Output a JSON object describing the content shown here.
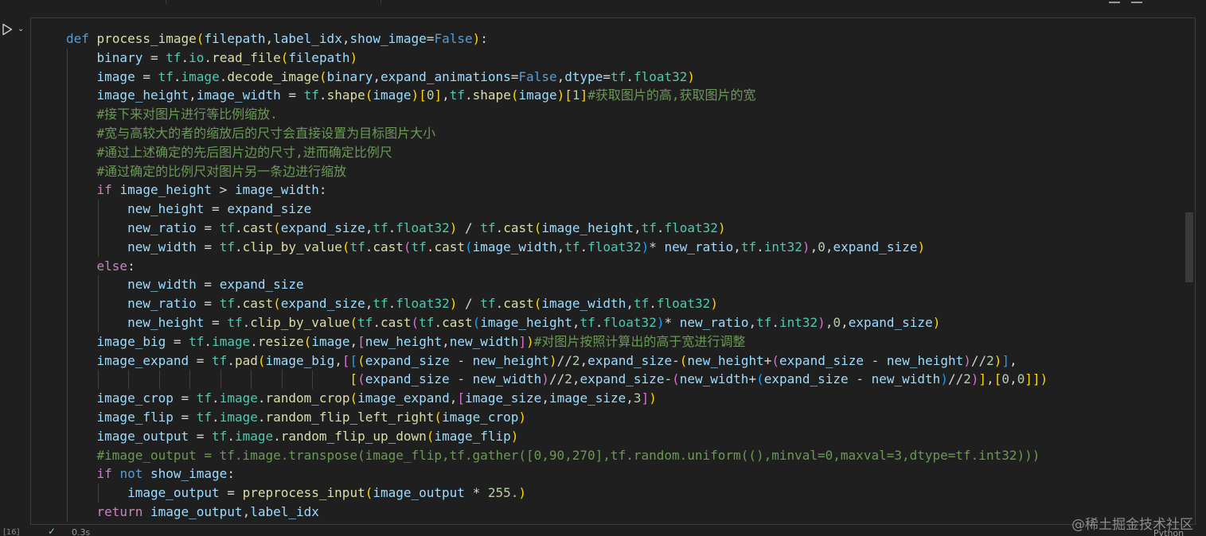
{
  "cell": {
    "execution_count": "[16]",
    "status": "0.3s",
    "language": "Python",
    "run_icon": "play-icon",
    "collapse_icon": "chevron-down-icon",
    "status_icon": "check-icon"
  },
  "watermark": "@稀土掘金技术社区",
  "code_lines": [
    "def process_image(filepath,label_idx,show_image=False):",
    "    binary = tf.io.read_file(filepath)",
    "    image = tf.image.decode_image(binary,expand_animations=False,dtype=tf.float32)",
    "    image_height,image_width = tf.shape(image)[0],tf.shape(image)[1]#获取图片的高,获取图片的宽",
    "    #接下来对图片进行等比例缩放.",
    "    #宽与高较大的者的缩放后的尺寸会直接设置为目标图片大小",
    "    #通过上述确定的先后图片边的尺寸,进而确定比例尺",
    "    #通过确定的比例尺对图片另一条边进行缩放",
    "    if image_height > image_width:",
    "        new_height = expand_size",
    "        new_ratio = tf.cast(expand_size,tf.float32) / tf.cast(image_height,tf.float32)",
    "        new_width = tf.clip_by_value(tf.cast(tf.cast(image_width,tf.float32)* new_ratio,tf.int32),0,expand_size)",
    "    else:",
    "        new_width = expand_size",
    "        new_ratio = tf.cast(expand_size,tf.float32) / tf.cast(image_width,tf.float32)",
    "        new_height = tf.clip_by_value(tf.cast(tf.cast(image_height,tf.float32)* new_ratio,tf.int32),0,expand_size)",
    "    image_big = tf.image.resize(image,[new_height,new_width])#对图片按照计算出的高于宽进行调整",
    "    image_expand = tf.pad(image_big,[[(expand_size - new_height)//2,expand_size-(new_height+(expand_size - new_height)//2)],",
    "                                     [(expand_size - new_width)//2,expand_size-(new_width+(expand_size - new_width)//2)],[0,0]])",
    "    image_crop = tf.image.random_crop(image_expand,[image_size,image_size,3])",
    "    image_flip = tf.image.random_flip_left_right(image_crop)",
    "    image_output = tf.image.random_flip_up_down(image_flip)",
    "    #image_output = tf.image.transpose(image_flip,tf.gather([0,90,270],tf.random.uniform((),minval=0,maxval=3,dtype=tf.int32)))",
    "    if not show_image:",
    "        image_output = preprocess_input(image_output * 255.)",
    "    return image_output,label_idx"
  ],
  "colors": {
    "keyword": "#569cd6",
    "control": "#c586c0",
    "function": "#dcdcaa",
    "variable": "#9cdcfe",
    "module": "#4ec9b0",
    "number": "#b5cea8",
    "comment": "#6a9955",
    "background": "#1f1f1f"
  }
}
